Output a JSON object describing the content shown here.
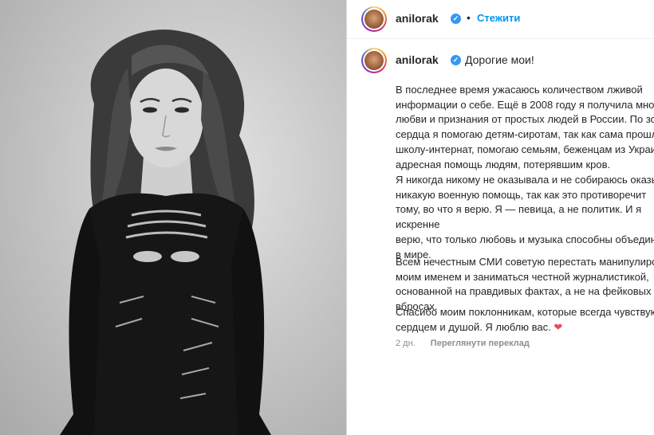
{
  "post": {
    "username": "anilorak",
    "verified_icon": "verified-badge-icon",
    "follow_label": "Стежити",
    "separator": "•",
    "image_alt": "Black and white portrait photo"
  },
  "caption": {
    "username": "anilorak",
    "first_line": "Дорогие мои!",
    "paragraphs": [
      "В последнее время ужасаюсь количеством лживой\nинформации о себе. Ещё в 2008 году я получила много\nлюбви и признания от простых людей в России. По зову\nсердца я помогаю детям-сиротам, так как сама прошла\nшколу-интернат, помогаю семьям, беженцам из Украины,\nадресная помощь людям, потерявшим кров.",
      "Я никогда никому не оказывала и не собираюсь оказывать\nникакую военную помощь, так как это противоречит\nтому, во что я верю. Я — певица, а не политик. И я искренне\nверю, что только любовь и музыка способны объединить\nв мире.",
      "Всем нечестным СМИ советую перестать манипулировать\nмоим именем и заниматься честной журналистикой,\nоснованной на правдивых фактах, а не на фейковых вбросах.",
      "Спасибо моим поклонникам, которые всегда чувствуют\nсердцем и душой. Я люблю вас."
    ],
    "heart": "❤",
    "time_ago": "2 дн.",
    "translate_label": "Переглянути переклад"
  },
  "colors": {
    "accent": "#0095f6",
    "verified": "#3897f0",
    "heart": "#ed4956",
    "muted": "#8e8e8e"
  }
}
